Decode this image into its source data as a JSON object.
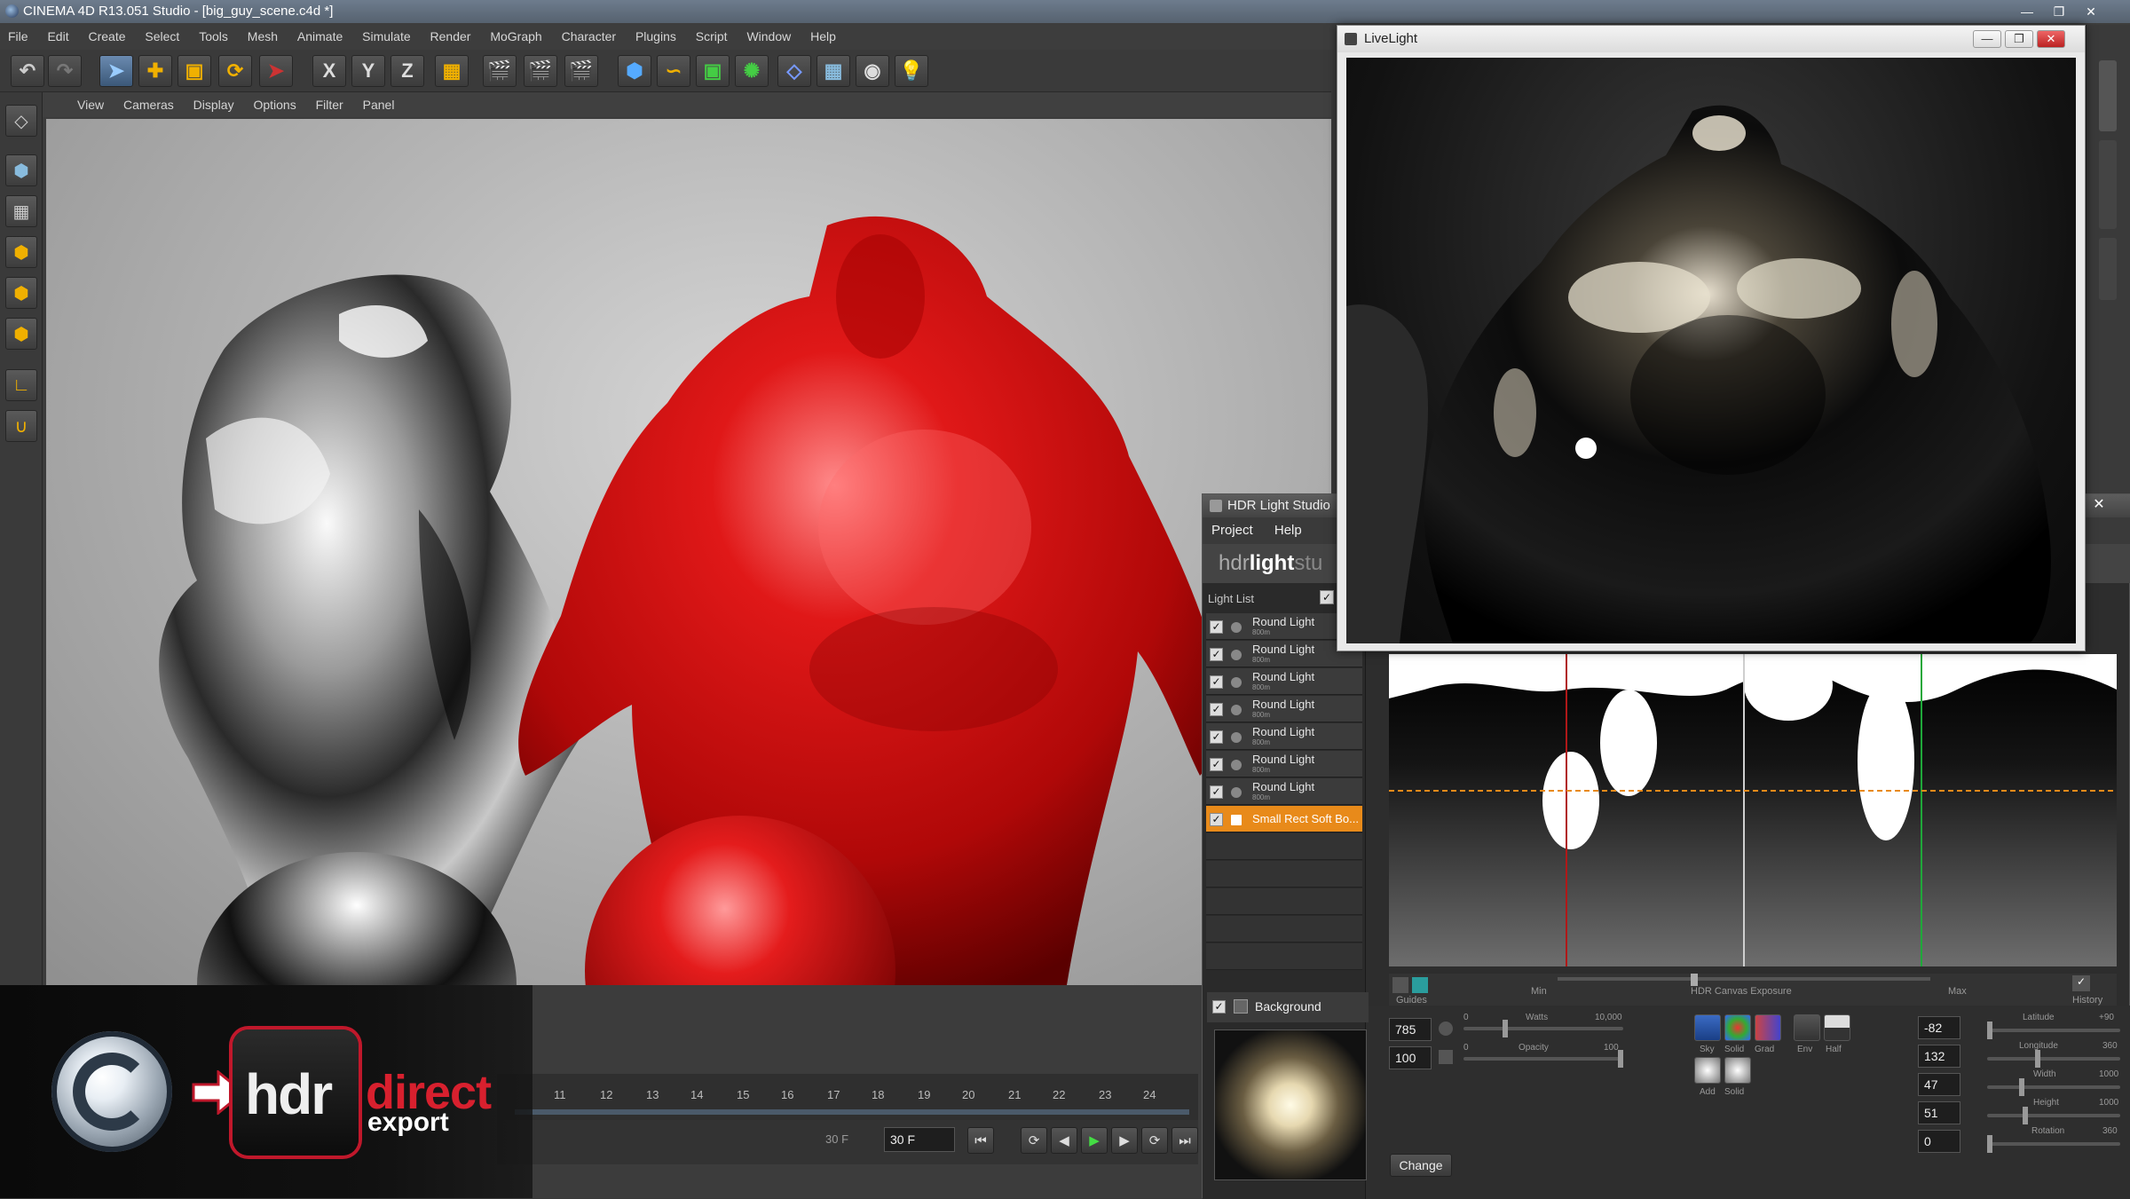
{
  "app": {
    "title": "CINEMA 4D R13.051 Studio - [big_guy_scene.c4d *]",
    "menu": [
      "File",
      "Edit",
      "Create",
      "Select",
      "Tools",
      "Mesh",
      "Animate",
      "Simulate",
      "Render",
      "MoGraph",
      "Character",
      "Plugins",
      "Script",
      "Window",
      "Help"
    ],
    "viewport_menu": [
      "View",
      "Cameras",
      "Display",
      "Options",
      "Filter",
      "Panel"
    ],
    "axis_buttons": [
      "X",
      "Y",
      "Z"
    ]
  },
  "timeline": {
    "ticks": [
      "11",
      "12",
      "13",
      "14",
      "15",
      "16",
      "17",
      "18",
      "19",
      "20",
      "21",
      "22",
      "23",
      "24"
    ],
    "frame_left": "30 F",
    "frame_right": "30 F"
  },
  "livelight": {
    "title": "LiveLight"
  },
  "hdr_light_studio": {
    "title": "HDR Light Studio",
    "menu": [
      "Project",
      "Help"
    ],
    "brand_normal": "hdr",
    "brand_bold": "light",
    "brand_tail": "stu",
    "light_list_label": "Light List",
    "lights": [
      {
        "name": "Round Light",
        "sub": "800m",
        "selected": false
      },
      {
        "name": "Round Light",
        "sub": "800m",
        "selected": false
      },
      {
        "name": "Round Light",
        "sub": "800m",
        "selected": false
      },
      {
        "name": "Round Light",
        "sub": "800m",
        "selected": false
      },
      {
        "name": "Round Light",
        "sub": "800m",
        "selected": false
      },
      {
        "name": "Round Light",
        "sub": "800m",
        "selected": false
      },
      {
        "name": "Round Light",
        "sub": "800m",
        "selected": false
      },
      {
        "name": "Small Rect Soft Bo...",
        "sub": "",
        "selected": true
      }
    ],
    "background_label": "Background",
    "change_button": "Change",
    "canvas_labels": {
      "guides": "Guides",
      "min": "Min",
      "exposure": "HDR Canvas Exposure",
      "max": "Max",
      "history": "History"
    },
    "props": {
      "val1": "785",
      "val2": "100",
      "watts_label": "Watts",
      "watts_max": "10,000",
      "watts_min": "0",
      "opacity_label": "Opacity",
      "opacity_min": "0",
      "opacity_max": "100",
      "style_labels": [
        "Sky",
        "Solid",
        "Grad",
        "Env",
        "Half"
      ],
      "style_labels2": [
        "Add",
        "Solid"
      ],
      "latitude": "-82",
      "longitude": "132",
      "width": "47",
      "height": "51",
      "rotation": "0",
      "lat_label": "Latitude",
      "lon_label": "Longitude",
      "width_label": "Width",
      "height_label": "Height",
      "rot_label": "Rotation",
      "lat_max": "+90",
      "lon_max": "360",
      "width_max": "1000",
      "height_max": "1000",
      "rot_max": "360"
    }
  },
  "banner": {
    "hdr": "hdr",
    "direct": "direct",
    "export": "export"
  },
  "colors": {
    "accent_orange": "#e88a1a",
    "brand_red": "#d8202e"
  }
}
